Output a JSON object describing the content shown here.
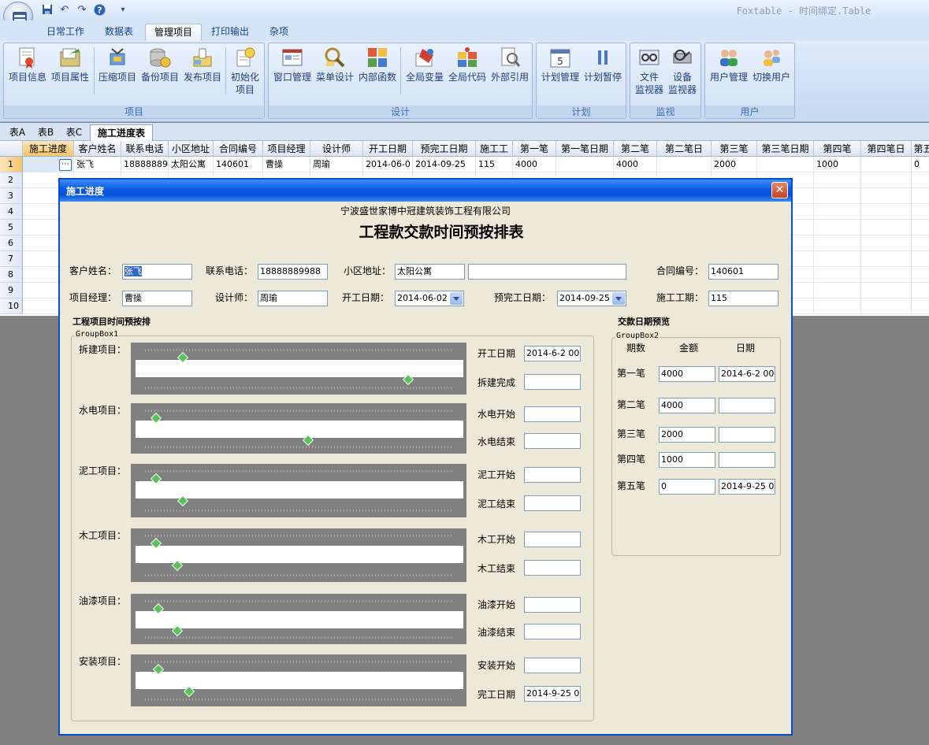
{
  "app": {
    "title": "Foxtable - 时间绑定.Table"
  },
  "quick_access": {
    "save": "save-icon",
    "undo": "undo-icon",
    "redo": "redo-icon",
    "help": "help-icon",
    "more": "▾"
  },
  "ribbon": {
    "tabs": [
      "日常工作",
      "数据表",
      "管理项目",
      "打印输出",
      "杂项"
    ],
    "active_tab": "管理项目",
    "groups": {
      "project": {
        "label": "项目",
        "buttons": [
          "项目信息",
          "项目属性",
          "压缩项目",
          "备份项目",
          "发布项目",
          "初始化",
          "项目"
        ]
      },
      "design": {
        "label": "设计",
        "buttons": [
          "窗口管理",
          "菜单设计",
          "内部函数",
          "全局变量",
          "全局代码",
          "外部引用"
        ]
      },
      "plan": {
        "label": "计划",
        "buttons": [
          "计划管理",
          "计划暂停"
        ]
      },
      "monitor": {
        "label": "监视",
        "buttons": [
          "文件",
          "监视器",
          "设备",
          "监视器"
        ]
      },
      "user": {
        "label": "用户",
        "buttons": [
          "用户管理",
          "切换用户"
        ]
      }
    }
  },
  "sheets": {
    "tabs": [
      "表A",
      "表B",
      "表C",
      "施工进度表"
    ],
    "active": "施工进度表"
  },
  "grid": {
    "columns": [
      "施工进度",
      "客户姓名",
      "联系电话",
      "小区地址",
      "合同编号",
      "项目经理",
      "设计师",
      "开工日期",
      "预完工日期",
      "施工工",
      "第一笔",
      "第一笔日期",
      "第二笔",
      "第二笔日",
      "第三笔",
      "第三笔日期",
      "第四笔",
      "第四笔日",
      "第五"
    ],
    "row_numbers": [
      "1",
      "2",
      "3",
      "4",
      "5",
      "6",
      "7",
      "8",
      "9",
      "10"
    ],
    "row1": [
      "张飞",
      "18888889",
      "太阳公寓",
      "140601",
      "曹操",
      "周瑜",
      "2014-06-0",
      "2014-09-25",
      "115",
      "4000",
      "",
      "4000",
      "",
      "2000",
      "",
      "1000",
      "",
      "0"
    ]
  },
  "dialog": {
    "title": "施工进度",
    "company": "宁波盛世家博中冠建筑装饰工程有限公司",
    "heading": "工程款交款时间预按排表",
    "customer_label": "客户姓名：",
    "customer": "张飞",
    "phone_label": "联系电话：",
    "phone": "18888889988",
    "address_label": "小区地址：",
    "address": "太阳公寓",
    "address_extra": "",
    "contract_label": "合同编号：",
    "contract": "140601",
    "manager_label": "项目经理：",
    "manager": "曹操",
    "designer_label": "设计师：",
    "designer": "周瑜",
    "start_label": "开工日期：",
    "start": "2014-06-02",
    "planned_end_label": "预完工日期：",
    "planned_end": "2014-09-25",
    "duration_label": "施工工期：",
    "duration": "115",
    "schedule_section": "工程项目时间预按排",
    "groupbox1": "GroupBox1",
    "payments_section": "交款日期预览",
    "groupbox2": "GroupBox2",
    "stages": [
      {
        "label": "拆建项目：",
        "start_label": "开工日期",
        "start": "2014-6-2 00",
        "end_label": "拆建完成",
        "end": "",
        "thumb_top": 0.12,
        "thumb_bottom": 0.86
      },
      {
        "label": "水电项目：",
        "start_label": "水电开始",
        "start": "",
        "end_label": "水电结束",
        "end": "",
        "thumb_top": 0.03,
        "thumb_bottom": 0.53
      },
      {
        "label": "泥工项目：",
        "start_label": "泥工开始",
        "start": "",
        "end_label": "泥工结束",
        "end": "",
        "thumb_top": 0.03,
        "thumb_bottom": 0.12
      },
      {
        "label": "木工项目：",
        "start_label": "木工开始",
        "start": "",
        "end_label": "木工结束",
        "end": "",
        "thumb_top": 0.03,
        "thumb_bottom": 0.1
      },
      {
        "label": "油漆项目：",
        "start_label": "油漆开始",
        "start": "",
        "end_label": "油漆结束",
        "end": "",
        "thumb_top": 0.04,
        "thumb_bottom": 0.1
      },
      {
        "label": "安装项目：",
        "start_label": "安装开始",
        "start": "",
        "end_label": "完工日期",
        "end": "2014-9-25 0",
        "thumb_top": 0.04,
        "thumb_bottom": 0.14
      }
    ],
    "payments_headers": [
      "期数",
      "金额",
      "日期"
    ],
    "payments": [
      {
        "label": "第一笔",
        "amount": "4000",
        "date": "2014-6-2 00"
      },
      {
        "label": "第二笔",
        "amount": "4000",
        "date": ""
      },
      {
        "label": "第三笔",
        "amount": "2000",
        "date": ""
      },
      {
        "label": "第四笔",
        "amount": "1000",
        "date": ""
      },
      {
        "label": "第五笔",
        "amount": "0",
        "date": "2014-9-25 0"
      }
    ]
  }
}
